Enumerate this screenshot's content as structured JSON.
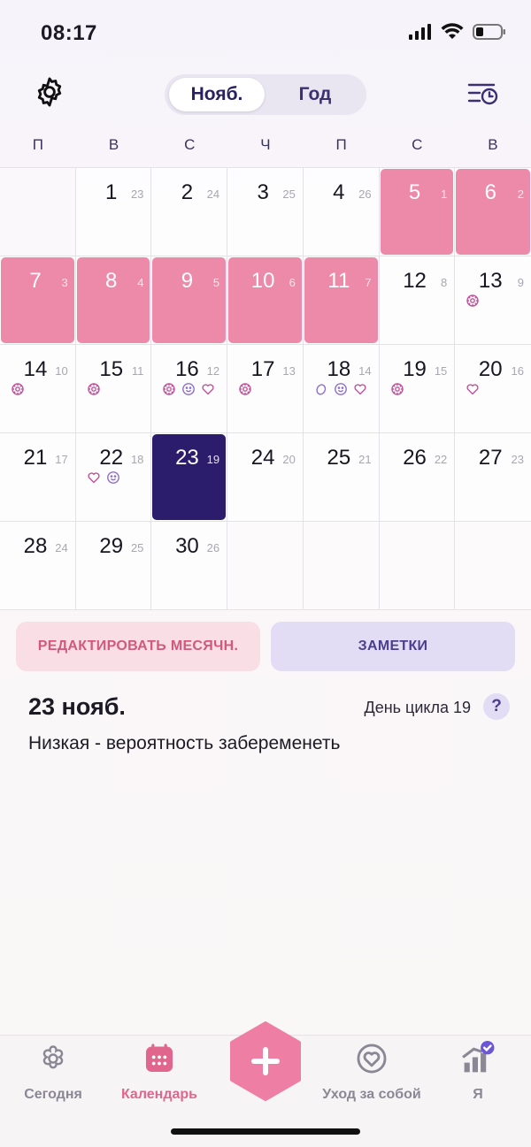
{
  "status": {
    "time": "08:17"
  },
  "header": {
    "tabs": [
      {
        "label": "Нояб.",
        "active": true
      },
      {
        "label": "Год",
        "active": false
      }
    ]
  },
  "weekdays": [
    "П",
    "В",
    "С",
    "Ч",
    "П",
    "С",
    "В"
  ],
  "calendar": {
    "leading_empty": 1,
    "trailing_empty": 4,
    "days": [
      {
        "d": "1",
        "c": "23",
        "state": "normal",
        "marks": []
      },
      {
        "d": "2",
        "c": "24",
        "state": "normal",
        "marks": []
      },
      {
        "d": "3",
        "c": "25",
        "state": "normal",
        "marks": []
      },
      {
        "d": "4",
        "c": "26",
        "state": "normal",
        "marks": []
      },
      {
        "d": "5",
        "c": "1",
        "state": "period",
        "marks": []
      },
      {
        "d": "6",
        "c": "2",
        "state": "period",
        "marks": []
      },
      {
        "d": "7",
        "c": "3",
        "state": "period",
        "marks": []
      },
      {
        "d": "8",
        "c": "4",
        "state": "period",
        "marks": []
      },
      {
        "d": "9",
        "c": "5",
        "state": "period",
        "marks": []
      },
      {
        "d": "10",
        "c": "6",
        "state": "period",
        "marks": []
      },
      {
        "d": "11",
        "c": "7",
        "state": "period",
        "marks": []
      },
      {
        "d": "12",
        "c": "8",
        "state": "normal",
        "marks": []
      },
      {
        "d": "13",
        "c": "9",
        "state": "normal",
        "marks": [
          "flower"
        ]
      },
      {
        "d": "14",
        "c": "10",
        "state": "normal",
        "marks": [
          "flower"
        ]
      },
      {
        "d": "15",
        "c": "11",
        "state": "normal",
        "marks": [
          "flower"
        ]
      },
      {
        "d": "16",
        "c": "12",
        "state": "normal",
        "marks": [
          "flower",
          "smile",
          "heart"
        ]
      },
      {
        "d": "17",
        "c": "13",
        "state": "normal",
        "marks": [
          "flower"
        ]
      },
      {
        "d": "18",
        "c": "14",
        "state": "normal",
        "marks": [
          "drop",
          "smile",
          "heart"
        ]
      },
      {
        "d": "19",
        "c": "15",
        "state": "normal",
        "marks": [
          "flower"
        ]
      },
      {
        "d": "20",
        "c": "16",
        "state": "normal",
        "marks": [
          "heart"
        ]
      },
      {
        "d": "21",
        "c": "17",
        "state": "normal",
        "marks": []
      },
      {
        "d": "22",
        "c": "18",
        "state": "normal",
        "marks": [
          "heart",
          "smile"
        ]
      },
      {
        "d": "23",
        "c": "19",
        "state": "today",
        "marks": []
      },
      {
        "d": "24",
        "c": "20",
        "state": "normal",
        "marks": []
      },
      {
        "d": "25",
        "c": "21",
        "state": "normal",
        "marks": []
      },
      {
        "d": "26",
        "c": "22",
        "state": "normal",
        "marks": []
      },
      {
        "d": "27",
        "c": "23",
        "state": "normal",
        "marks": []
      },
      {
        "d": "28",
        "c": "24",
        "state": "normal",
        "marks": []
      },
      {
        "d": "29",
        "c": "25",
        "state": "normal",
        "marks": []
      },
      {
        "d": "30",
        "c": "26",
        "state": "normal",
        "marks": []
      }
    ]
  },
  "actions": {
    "edit_label": "РЕДАКТИРОВАТЬ МЕСЯЧН.",
    "notes_label": "ЗАМЕТКИ"
  },
  "day_info": {
    "date": "23 нояб.",
    "cycle_day": "День цикла 19",
    "help": "?",
    "probability": "Низкая - вероятность забеременеть"
  },
  "tabbar": {
    "items": [
      {
        "label": "Сегодня",
        "icon": "flower-icon",
        "active": false
      },
      {
        "label": "Календарь",
        "icon": "calendar-icon",
        "active": true
      },
      {
        "label": "Уход за собой",
        "icon": "heart-circle-icon",
        "active": false
      },
      {
        "label": "Я",
        "icon": "profile-chart-icon",
        "active": false
      }
    ]
  },
  "colors": {
    "period": "#ee8aa9",
    "today": "#2b1d6b",
    "accent": "#e0668d",
    "mark": "#c2529b",
    "mark_purple": "#8b6fd0"
  }
}
